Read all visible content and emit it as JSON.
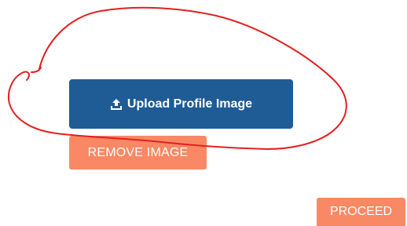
{
  "buttons": {
    "upload_label": "Upload Profile Image",
    "remove_label": "REMOVE IMAGE",
    "proceed_label": "PROCEED"
  },
  "icons": {
    "upload": "upload-icon"
  },
  "colors": {
    "upload_button": "#1f5c96",
    "secondary_button": "#f98864",
    "annotation_circle": "#e41f1f"
  }
}
